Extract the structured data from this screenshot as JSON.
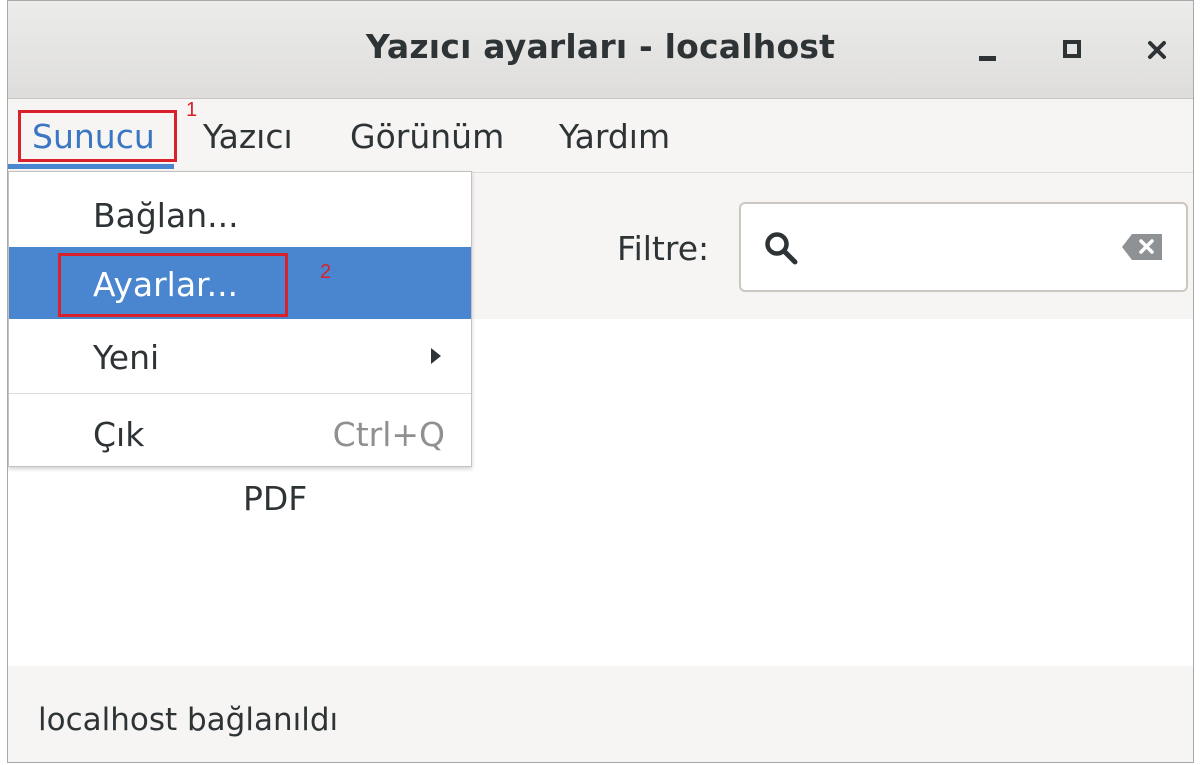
{
  "window": {
    "title": "Yazıcı ayarları - localhost"
  },
  "menubar": {
    "items": [
      "Sunucu",
      "Yazıcı",
      "Görünüm",
      "Yardım"
    ]
  },
  "dropdown": {
    "items": [
      {
        "label": "Bağlan..."
      },
      {
        "label": "Ayarlar..."
      },
      {
        "label": "Yeni",
        "submenu": true
      },
      {
        "label": "Çık",
        "accel": "Ctrl+Q"
      }
    ]
  },
  "toolbar": {
    "filter_label": "Filtre:",
    "search_value": ""
  },
  "content": {
    "printer_label": "PDF"
  },
  "status": {
    "text": "localhost bağlanıldı"
  },
  "annotations": [
    "1",
    "2"
  ],
  "colors": {
    "accent": "#4a86cf",
    "annotation": "#d9212b"
  },
  "icons": [
    "minimize-icon",
    "maximize-icon",
    "close-icon",
    "search-icon",
    "clear-icon",
    "submenu-arrow-icon"
  ]
}
